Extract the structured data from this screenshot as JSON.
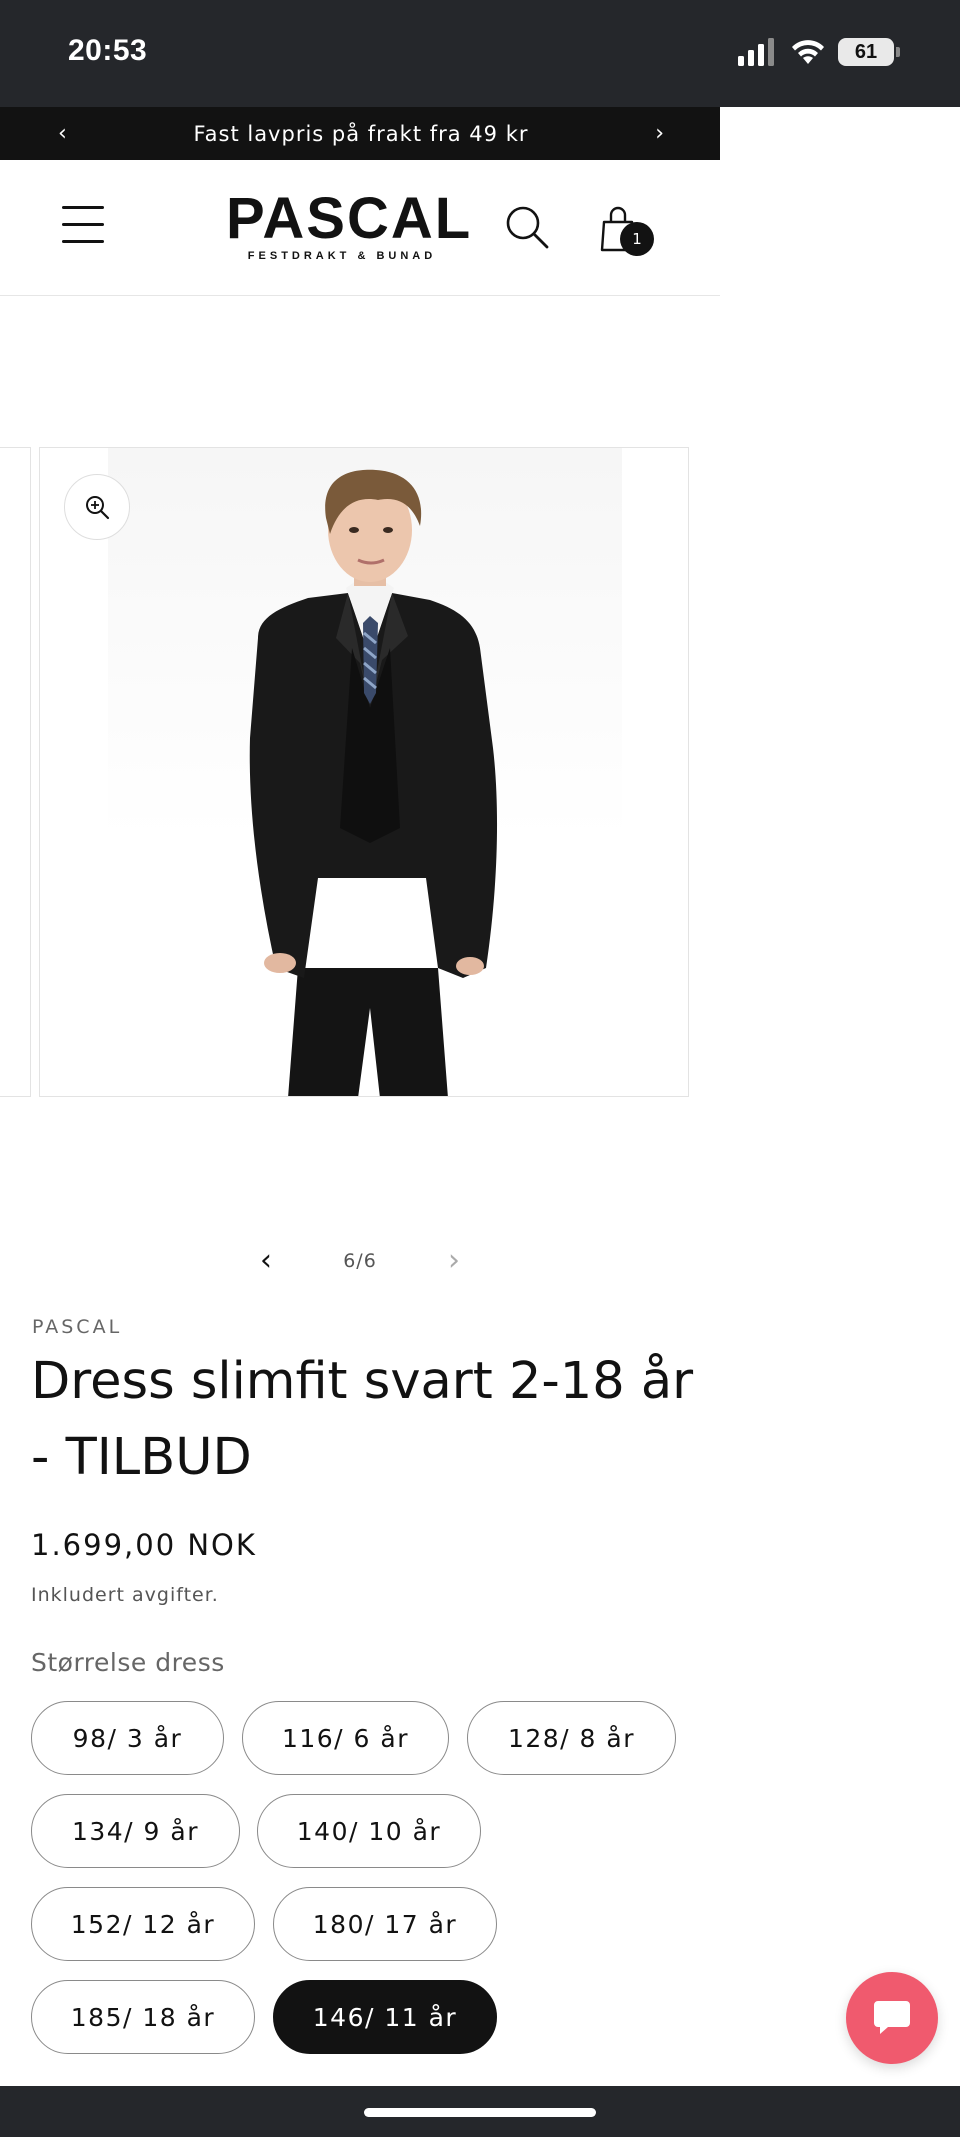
{
  "status_bar": {
    "time": "20:53",
    "battery": "61",
    "icons": [
      "signal-icon",
      "wifi-icon",
      "battery-icon"
    ]
  },
  "announcement": {
    "text": "Fast lavpris på frakt fra 49 kr",
    "prev_icon": "chevron-left-icon",
    "next_icon": "chevron-right-icon"
  },
  "header": {
    "logo_main": "PASCAL",
    "logo_sub": "FESTDRAKT & BUNAD",
    "cart_count": "1",
    "icons": [
      "menu-icon",
      "search-icon",
      "shopping-bag-icon"
    ]
  },
  "gallery": {
    "counter": "6/6",
    "zoom_icon": "zoom-in-icon"
  },
  "product": {
    "vendor": "PASCAL",
    "title": "Dress slimfit svart 2-18 år - TILBUD",
    "price": "1.699,00 NOK",
    "tax_note": "Inkludert avgifter.",
    "size_label": "Størrelse dress",
    "sizes": [
      {
        "label": "98/ 3 år",
        "selected": false
      },
      {
        "label": "116/ 6 år",
        "selected": false
      },
      {
        "label": "128/ 8 år",
        "selected": false
      },
      {
        "label": "134/ 9 år",
        "selected": false
      },
      {
        "label": "140/ 10 år",
        "selected": false
      },
      {
        "label": "152/ 12 år",
        "selected": false
      },
      {
        "label": "180/ 17 år",
        "selected": false
      },
      {
        "label": "185/ 18 år",
        "selected": false
      },
      {
        "label": "146/ 11 år",
        "selected": true
      }
    ]
  },
  "chat": {
    "icon": "chat-bubble-icon"
  },
  "colors": {
    "dark": "#121212",
    "status_bar": "#25272b",
    "chat_accent": "#f05a6e"
  }
}
